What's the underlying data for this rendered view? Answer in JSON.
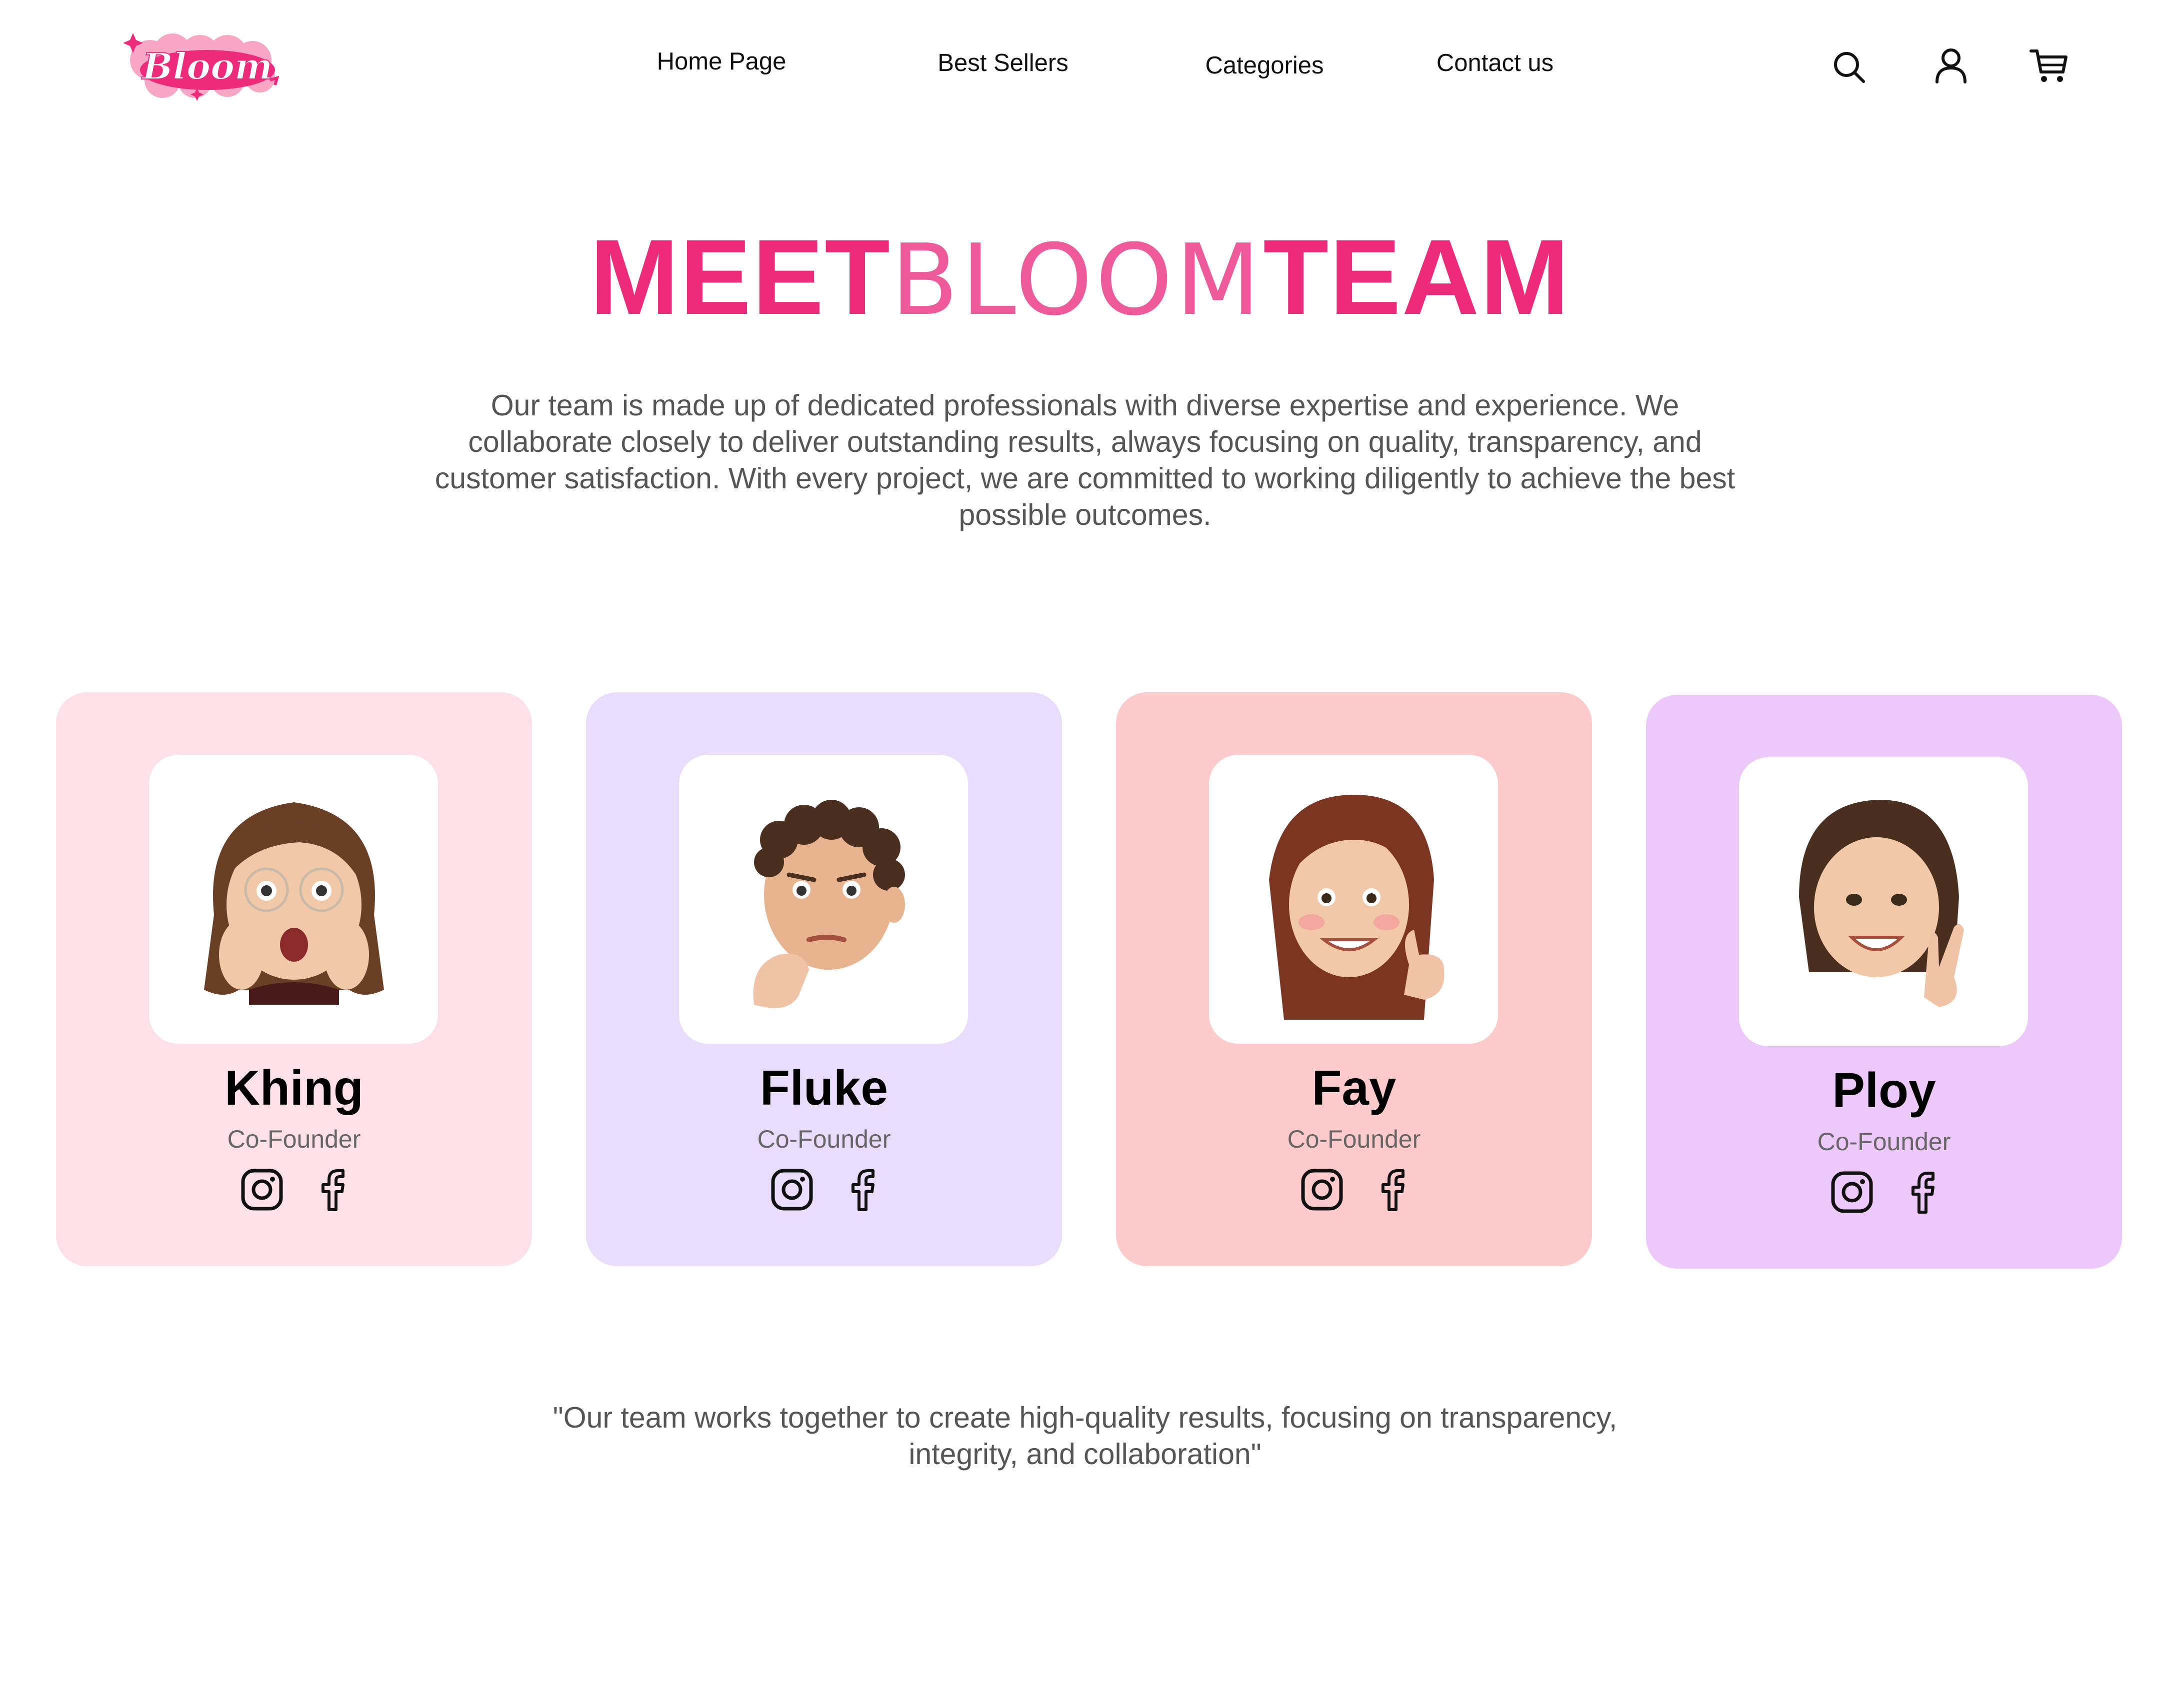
{
  "brand": {
    "logo_text": "Bloom",
    "accent": "#ee2a7b"
  },
  "nav": {
    "links": [
      "Home Page",
      "Best Sellers",
      "Categories",
      "Contact us"
    ],
    "icons": [
      "search-icon",
      "user-icon",
      "cart-icon"
    ]
  },
  "hero": {
    "title_part1": "MEET",
    "title_part2": "BLOOM",
    "title_part3": "TEAM",
    "intro": "Our team is made up of dedicated professionals with diverse expertise and experience. We collaborate closely to deliver outstanding results, always focusing on quality, transparency, and customer satisfaction. With every project, we are committed to working diligently to achieve the best possible outcomes."
  },
  "team": [
    {
      "name": "Khing",
      "role": "Co-Founder",
      "bg": "#fde0e8"
    },
    {
      "name": "Fluke",
      "role": "Co-Founder",
      "bg": "#eadcfd"
    },
    {
      "name": "Fay",
      "role": "Co-Founder",
      "bg": "#fdcbcb"
    },
    {
      "name": "Ploy",
      "role": "Co-Founder",
      "bg": "#edc8fb"
    }
  ],
  "quote": "\"Our team works together to create high-quality results, focusing on transparency, integrity, and collaboration\""
}
